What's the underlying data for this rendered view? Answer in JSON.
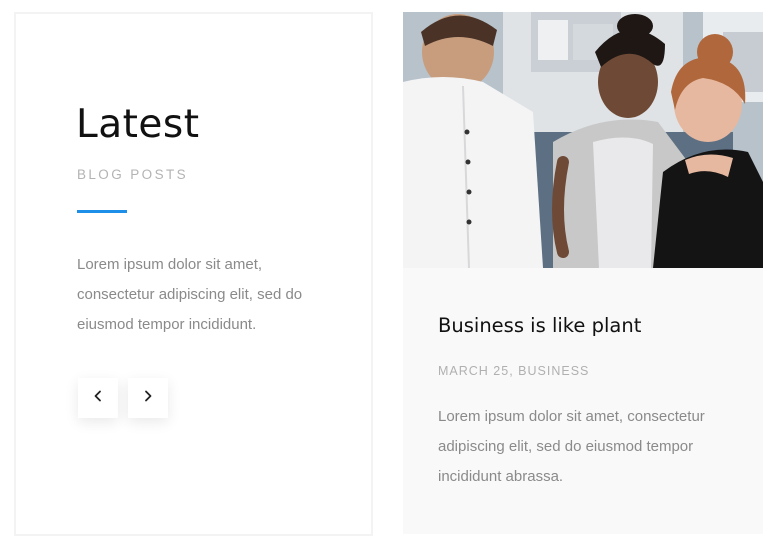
{
  "intro_card": {
    "heading": "Latest",
    "subheading": "BLOG POSTS",
    "description": "Lorem ipsum dolor sit amet, consectetur adipiscing elit, sed do eiusmod tempor incididunt.",
    "prev_icon": "chevron-left-icon",
    "next_icon": "chevron-right-icon",
    "accent_color": "#1e8fe8"
  },
  "post": {
    "image": "team-meeting-photo",
    "title": "Business is like plant",
    "meta": "MARCH 25, BUSINESS",
    "excerpt": "Lorem ipsum dolor sit amet, consectetur adipiscing elit, sed do eiusmod tempor incididunt abrassa."
  }
}
